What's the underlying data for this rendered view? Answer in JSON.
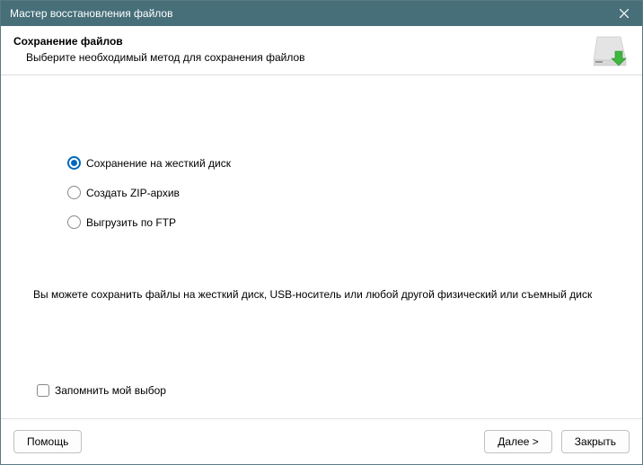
{
  "titlebar": {
    "title": "Мастер восстановления файлов"
  },
  "header": {
    "title": "Сохранение файлов",
    "subtitle": "Выберите необходимый метод для сохранения файлов"
  },
  "options": {
    "hdd": "Сохранение на жесткий диск",
    "zip": "Создать ZIP-архив",
    "ftp": "Выгрузить по FTP",
    "selected": "hdd"
  },
  "description": "Вы можете сохранить файлы на жесткий диск, USB-носитель или любой другой физический или съемный диск",
  "remember": {
    "label": "Запомнить мой выбор",
    "checked": false
  },
  "buttons": {
    "help": "Помощь",
    "next": "Далее >",
    "close": "Закрыть"
  }
}
